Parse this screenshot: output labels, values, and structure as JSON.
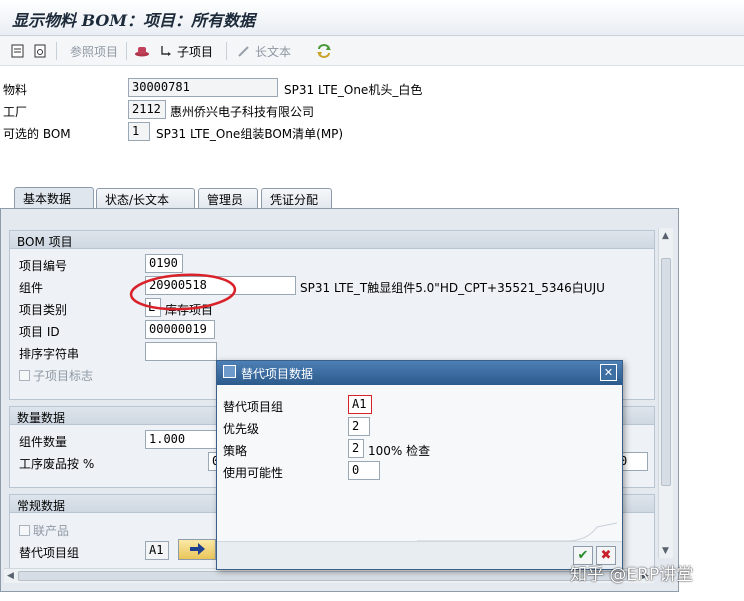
{
  "window": {
    "title": "显示物料 BOM：项目：所有数据"
  },
  "toolbar": {
    "ref_item": "参照项目",
    "sub_item": "子项目",
    "long_text": "长文本"
  },
  "header": {
    "material_label": "物料",
    "material_value": "30000781",
    "material_desc": "SP31 LTE_One机头_白色",
    "plant_label": "工厂",
    "plant_value": "2112",
    "plant_desc": "惠州侨兴电子科技有限公司",
    "alt_bom_label": "可选的 BOM",
    "alt_bom_value": "1",
    "alt_bom_desc": "SP31 LTE_One组装BOM清单(MP)"
  },
  "tabs": [
    "基本数据",
    "状态/长文本",
    "管理员",
    "凭证分配"
  ],
  "bom_item": {
    "title": "BOM 项目",
    "item_no_label": "项目编号",
    "item_no": "0190",
    "component_label": "组件",
    "component_value": "20900518",
    "component_desc": "SP31 LTE_T触显组件5.0\"HD_CPT+35521_5346白UJU",
    "category_label": "项目类别",
    "category_value": "L",
    "category_desc": "库存项目",
    "item_id_label": "项目 ID",
    "item_id": "00000019",
    "sort_label": "排序字符串",
    "subitem_label": "子项目标志"
  },
  "qty_data": {
    "title": "数量数据",
    "qty_label": "组件数量",
    "qty_value": "1.000",
    "scrap_label": "工序废品按 %",
    "scrap_value_left": "0",
    "scrap_value_right": "0"
  },
  "general": {
    "title": "常规数据",
    "coproduct_label": "联产品",
    "alt_group_label": "替代项目组",
    "alt_group_value": "A1"
  },
  "dialog": {
    "title": "替代项目数据",
    "group_label": "替代项目组",
    "group_value": "A1",
    "priority_label": "优先级",
    "priority_value": "2",
    "strategy_label": "策略",
    "strategy_value": "2",
    "strategy_desc": "100% 检查",
    "usage_label": "使用可能性",
    "usage_value": "0"
  },
  "watermark": "知乎 @ERP讲堂"
}
